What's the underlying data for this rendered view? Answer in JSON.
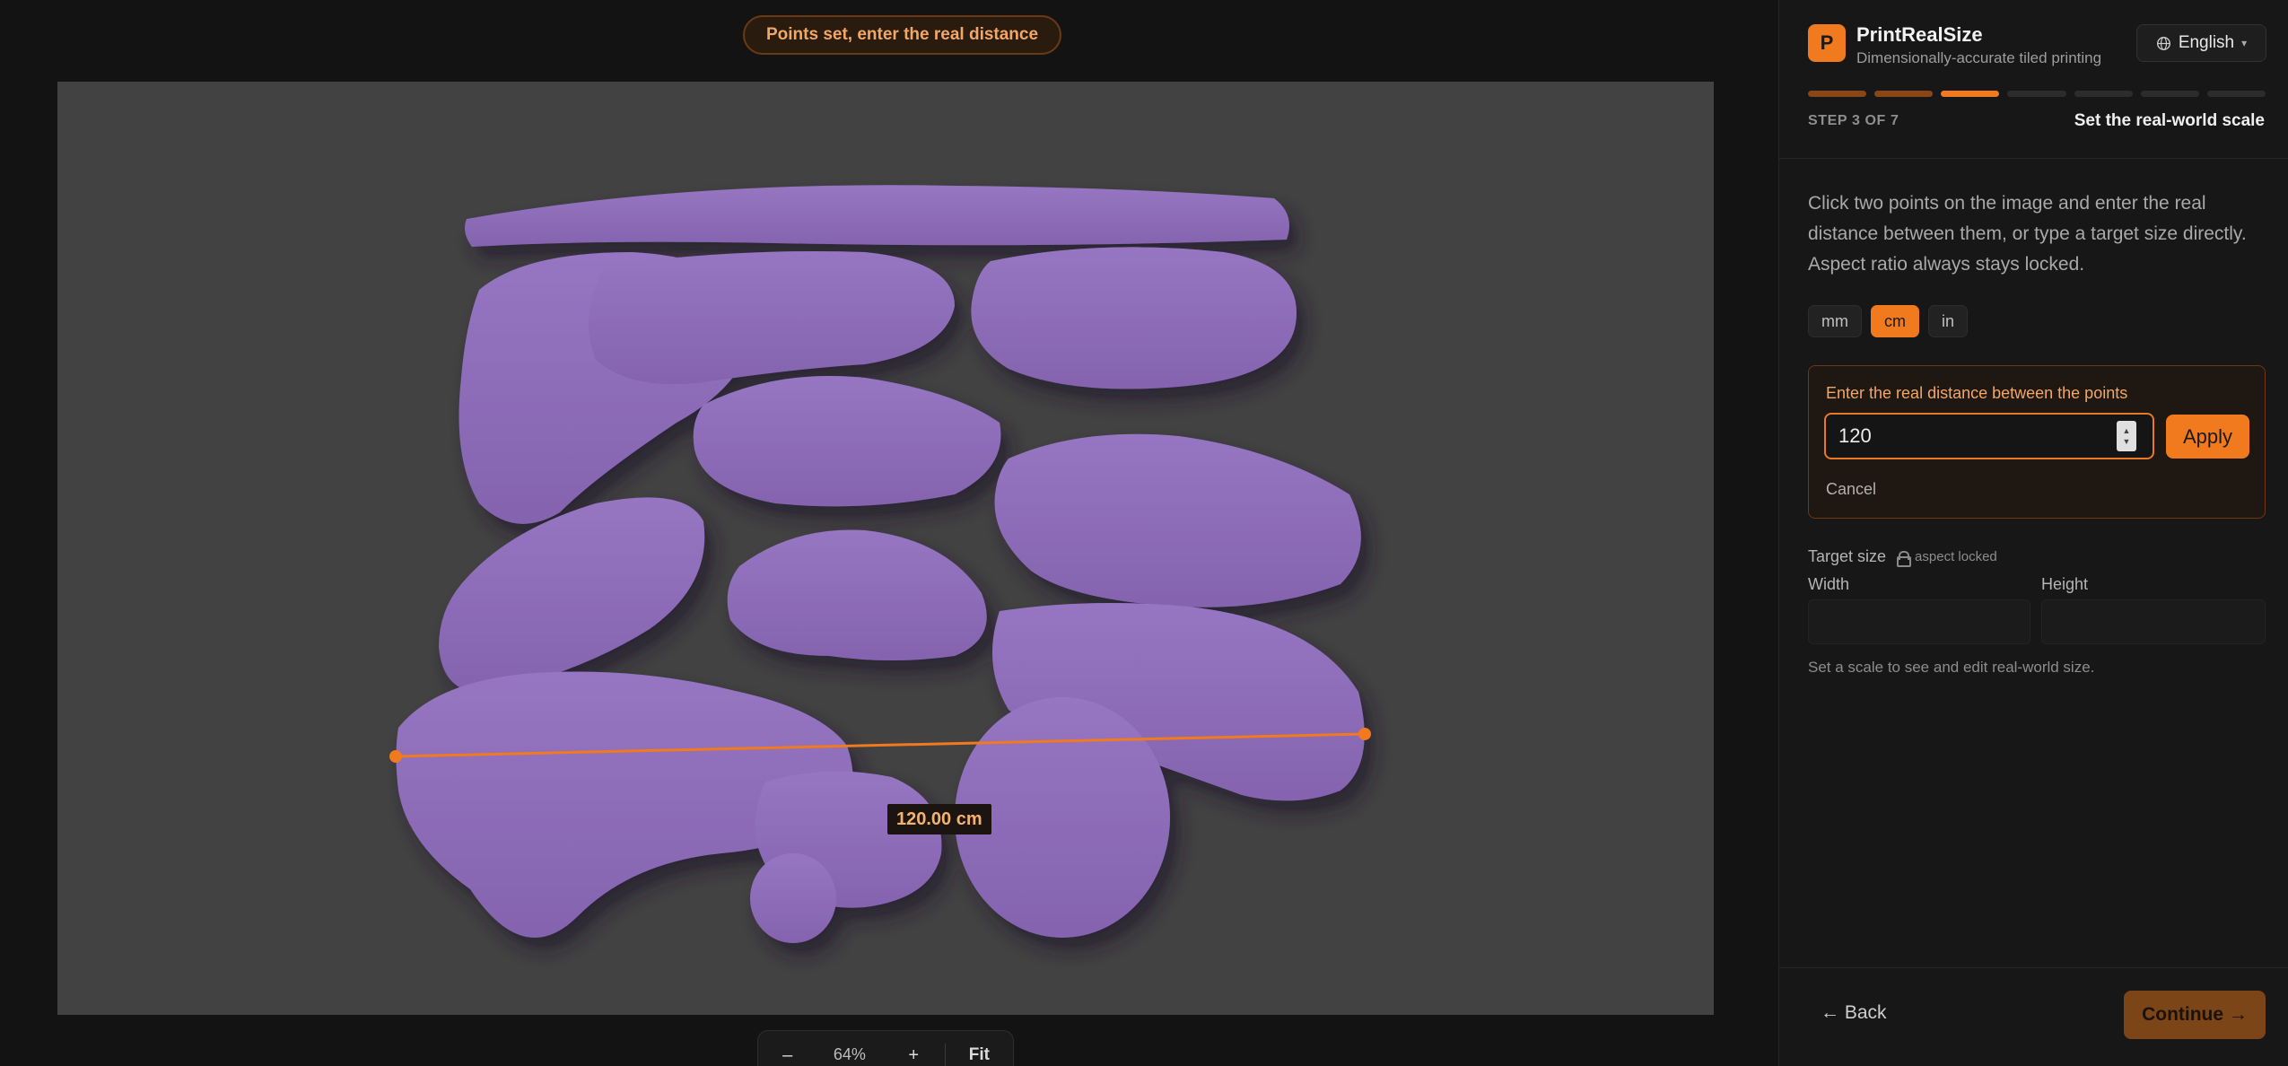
{
  "status_pill": "Points set, enter the real distance",
  "canvas": {
    "measurement_label": "120.00 cm"
  },
  "zoom": {
    "minus": "–",
    "value": "64%",
    "plus": "+",
    "fit": "Fit"
  },
  "brand": {
    "logo_letter": "P",
    "name": "PrintRealSize",
    "tagline": "Dimensionally-accurate tiled printing"
  },
  "language": {
    "icon": "globe-icon",
    "label": "English"
  },
  "steps": {
    "total": 7,
    "current": 3,
    "counter": "STEP 3 OF 7",
    "title": "Set the real-world scale"
  },
  "instructions": "Click two points on the image and enter the real distance between them, or type a target size directly. Aspect ratio always stays locked.",
  "units": {
    "mm": "mm",
    "cm": "cm",
    "in": "in",
    "selected": "cm"
  },
  "distance": {
    "label": "Enter the real distance between the points",
    "value": "120",
    "apply": "Apply",
    "cancel": "Cancel"
  },
  "target_size": {
    "label": "Target size",
    "lock_note": "aspect locked",
    "width_label": "Width",
    "height_label": "Height",
    "width_value": "",
    "height_value": "",
    "hint": "Set a scale to see and edit real-world size."
  },
  "nav": {
    "back": "← Back",
    "continue": "Continue →"
  },
  "colors": {
    "accent": "#f07a1d",
    "shape_fill": "#8e6cb8",
    "canvas_bg": "#424242"
  }
}
